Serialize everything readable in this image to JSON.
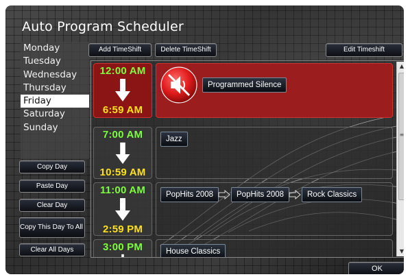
{
  "window": {
    "title": "Auto Program Scheduler"
  },
  "days": {
    "items": [
      "Monday",
      "Tuesday",
      "Wednesday",
      "Thursday",
      "Friday",
      "Saturday",
      "Sunday"
    ],
    "selected": "Friday"
  },
  "left_buttons": {
    "copy_day": "Copy Day",
    "paste_day": "Paste Day",
    "clear_day": "Clear Day",
    "copy_to_all": "Copy This Day To All D",
    "clear_all": "Clear All Days"
  },
  "toolbar": {
    "add_timeshift": "Add TimeShift",
    "delete_timeshift": "Delete TimeShift",
    "edit_timeshift": "Edit Timeshift"
  },
  "slots": [
    {
      "start": "12:00 AM",
      "end": "6:59 AM",
      "active": true,
      "programs": [
        "Programmed Silence"
      ]
    },
    {
      "start": "7:00 AM",
      "end": "10:59 AM",
      "active": false,
      "programs": [
        "Jazz"
      ]
    },
    {
      "start": "11:00 AM",
      "end": "2:59 PM",
      "active": false,
      "programs": [
        "PopHits 2008",
        "PopHits 2008",
        "Rock Classics"
      ]
    },
    {
      "start": "3:00 PM",
      "end": "",
      "active": false,
      "programs": [
        "House Classics"
      ]
    }
  ],
  "footer": {
    "ok_label": "OK"
  },
  "colors": {
    "start_time": "#7dff3c",
    "end_time": "#ffe11a",
    "active_slot": "#9b1d1d",
    "silence_icon": "#e01b1b"
  },
  "icons": {
    "silence": "speaker-muted-icon",
    "time_arrow": "arrow-down-icon",
    "chain": "arrow-right-icon"
  }
}
